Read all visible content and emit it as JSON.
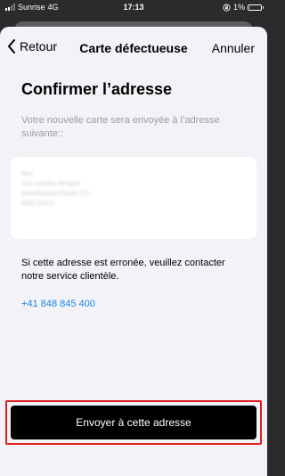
{
  "status_bar": {
    "carrier": "Sunrise",
    "network": "4G",
    "time": "17:13",
    "battery_percent": "1%",
    "battery_level": 0.01
  },
  "nav": {
    "back_label": "Retour",
    "title": "Carte défectueuse",
    "cancel_label": "Annuler"
  },
  "content": {
    "heading": "Confirmer l’adresse",
    "subtitle": "Votre nouvelle carte sera envoyée à l’adresse suivante::",
    "address_lines": [
      "Herr",
      "Juri Leander Sinapiet",
      "Schaffhauserstrasse 371",
      "8050 Zürich"
    ],
    "info_text": "Si cette adresse est erronée, veuillez contacter notre service clientèle.",
    "phone": "+41 848 845 400"
  },
  "footer": {
    "cta_label": "Envoyer à cette adresse"
  },
  "colors": {
    "link": "#1e88e5",
    "highlight_border": "#e02020",
    "cta_background": "#000000"
  }
}
